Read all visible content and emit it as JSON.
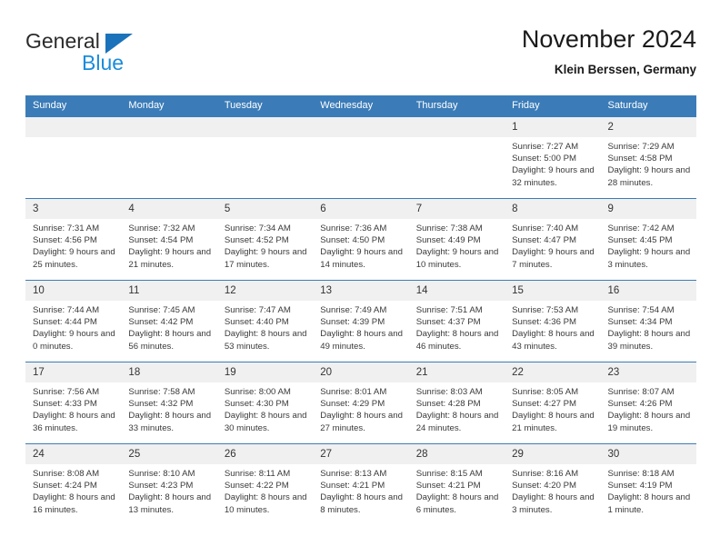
{
  "brand": {
    "name_part1": "General",
    "name_part2": "Blue",
    "triangle_color": "#1a72bb",
    "blue_color": "#1a8cdb"
  },
  "header": {
    "title": "November 2024",
    "subtitle": "Klein Berssen, Germany",
    "accent_color": "#3b7cb8",
    "daynum_band_color": "#f0f0f0"
  },
  "weekdays": [
    "Sunday",
    "Monday",
    "Tuesday",
    "Wednesday",
    "Thursday",
    "Friday",
    "Saturday"
  ],
  "labels": {
    "sunrise": "Sunrise:",
    "sunset": "Sunset:",
    "daylight": "Daylight:"
  },
  "weeks": [
    [
      {
        "day": "",
        "empty": true
      },
      {
        "day": "",
        "empty": true
      },
      {
        "day": "",
        "empty": true
      },
      {
        "day": "",
        "empty": true
      },
      {
        "day": "",
        "empty": true
      },
      {
        "day": "1",
        "sunrise": "Sunrise: 7:27 AM",
        "sunset": "Sunset: 5:00 PM",
        "daylight": "Daylight: 9 hours and 32 minutes."
      },
      {
        "day": "2",
        "sunrise": "Sunrise: 7:29 AM",
        "sunset": "Sunset: 4:58 PM",
        "daylight": "Daylight: 9 hours and 28 minutes."
      }
    ],
    [
      {
        "day": "3",
        "sunrise": "Sunrise: 7:31 AM",
        "sunset": "Sunset: 4:56 PM",
        "daylight": "Daylight: 9 hours and 25 minutes."
      },
      {
        "day": "4",
        "sunrise": "Sunrise: 7:32 AM",
        "sunset": "Sunset: 4:54 PM",
        "daylight": "Daylight: 9 hours and 21 minutes."
      },
      {
        "day": "5",
        "sunrise": "Sunrise: 7:34 AM",
        "sunset": "Sunset: 4:52 PM",
        "daylight": "Daylight: 9 hours and 17 minutes."
      },
      {
        "day": "6",
        "sunrise": "Sunrise: 7:36 AM",
        "sunset": "Sunset: 4:50 PM",
        "daylight": "Daylight: 9 hours and 14 minutes."
      },
      {
        "day": "7",
        "sunrise": "Sunrise: 7:38 AM",
        "sunset": "Sunset: 4:49 PM",
        "daylight": "Daylight: 9 hours and 10 minutes."
      },
      {
        "day": "8",
        "sunrise": "Sunrise: 7:40 AM",
        "sunset": "Sunset: 4:47 PM",
        "daylight": "Daylight: 9 hours and 7 minutes."
      },
      {
        "day": "9",
        "sunrise": "Sunrise: 7:42 AM",
        "sunset": "Sunset: 4:45 PM",
        "daylight": "Daylight: 9 hours and 3 minutes."
      }
    ],
    [
      {
        "day": "10",
        "sunrise": "Sunrise: 7:44 AM",
        "sunset": "Sunset: 4:44 PM",
        "daylight": "Daylight: 9 hours and 0 minutes."
      },
      {
        "day": "11",
        "sunrise": "Sunrise: 7:45 AM",
        "sunset": "Sunset: 4:42 PM",
        "daylight": "Daylight: 8 hours and 56 minutes."
      },
      {
        "day": "12",
        "sunrise": "Sunrise: 7:47 AM",
        "sunset": "Sunset: 4:40 PM",
        "daylight": "Daylight: 8 hours and 53 minutes."
      },
      {
        "day": "13",
        "sunrise": "Sunrise: 7:49 AM",
        "sunset": "Sunset: 4:39 PM",
        "daylight": "Daylight: 8 hours and 49 minutes."
      },
      {
        "day": "14",
        "sunrise": "Sunrise: 7:51 AM",
        "sunset": "Sunset: 4:37 PM",
        "daylight": "Daylight: 8 hours and 46 minutes."
      },
      {
        "day": "15",
        "sunrise": "Sunrise: 7:53 AM",
        "sunset": "Sunset: 4:36 PM",
        "daylight": "Daylight: 8 hours and 43 minutes."
      },
      {
        "day": "16",
        "sunrise": "Sunrise: 7:54 AM",
        "sunset": "Sunset: 4:34 PM",
        "daylight": "Daylight: 8 hours and 39 minutes."
      }
    ],
    [
      {
        "day": "17",
        "sunrise": "Sunrise: 7:56 AM",
        "sunset": "Sunset: 4:33 PM",
        "daylight": "Daylight: 8 hours and 36 minutes."
      },
      {
        "day": "18",
        "sunrise": "Sunrise: 7:58 AM",
        "sunset": "Sunset: 4:32 PM",
        "daylight": "Daylight: 8 hours and 33 minutes."
      },
      {
        "day": "19",
        "sunrise": "Sunrise: 8:00 AM",
        "sunset": "Sunset: 4:30 PM",
        "daylight": "Daylight: 8 hours and 30 minutes."
      },
      {
        "day": "20",
        "sunrise": "Sunrise: 8:01 AM",
        "sunset": "Sunset: 4:29 PM",
        "daylight": "Daylight: 8 hours and 27 minutes."
      },
      {
        "day": "21",
        "sunrise": "Sunrise: 8:03 AM",
        "sunset": "Sunset: 4:28 PM",
        "daylight": "Daylight: 8 hours and 24 minutes."
      },
      {
        "day": "22",
        "sunrise": "Sunrise: 8:05 AM",
        "sunset": "Sunset: 4:27 PM",
        "daylight": "Daylight: 8 hours and 21 minutes."
      },
      {
        "day": "23",
        "sunrise": "Sunrise: 8:07 AM",
        "sunset": "Sunset: 4:26 PM",
        "daylight": "Daylight: 8 hours and 19 minutes."
      }
    ],
    [
      {
        "day": "24",
        "sunrise": "Sunrise: 8:08 AM",
        "sunset": "Sunset: 4:24 PM",
        "daylight": "Daylight: 8 hours and 16 minutes."
      },
      {
        "day": "25",
        "sunrise": "Sunrise: 8:10 AM",
        "sunset": "Sunset: 4:23 PM",
        "daylight": "Daylight: 8 hours and 13 minutes."
      },
      {
        "day": "26",
        "sunrise": "Sunrise: 8:11 AM",
        "sunset": "Sunset: 4:22 PM",
        "daylight": "Daylight: 8 hours and 10 minutes."
      },
      {
        "day": "27",
        "sunrise": "Sunrise: 8:13 AM",
        "sunset": "Sunset: 4:21 PM",
        "daylight": "Daylight: 8 hours and 8 minutes."
      },
      {
        "day": "28",
        "sunrise": "Sunrise: 8:15 AM",
        "sunset": "Sunset: 4:21 PM",
        "daylight": "Daylight: 8 hours and 6 minutes."
      },
      {
        "day": "29",
        "sunrise": "Sunrise: 8:16 AM",
        "sunset": "Sunset: 4:20 PM",
        "daylight": "Daylight: 8 hours and 3 minutes."
      },
      {
        "day": "30",
        "sunrise": "Sunrise: 8:18 AM",
        "sunset": "Sunset: 4:19 PM",
        "daylight": "Daylight: 8 hours and 1 minute."
      }
    ]
  ]
}
